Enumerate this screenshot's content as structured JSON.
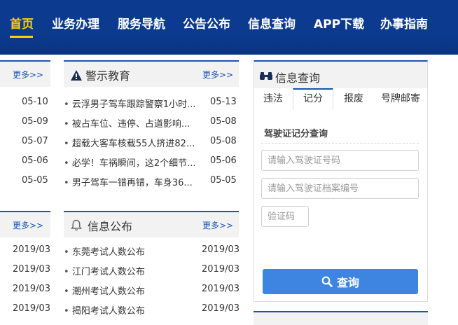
{
  "nav": {
    "items": [
      "首页",
      "业务办理",
      "服务导航",
      "公告公布",
      "信息查询",
      "APP下载",
      "办事指南"
    ]
  },
  "left_top": {
    "more": "更多>>",
    "dates": [
      "05-10",
      "05-09",
      "05-07",
      "05-06",
      "05-05"
    ]
  },
  "warning": {
    "title": "警示教育",
    "more": "更多>>",
    "rows": [
      {
        "text": "云浮男子驾车跟踪警察1小时...",
        "date": "05-13"
      },
      {
        "text": "被占车位、违停、占道影响...",
        "date": "05-08"
      },
      {
        "text": "超载大客车核载55人挤进82...",
        "date": "05-08"
      },
      {
        "text": "必学！车祸瞬间，这2个细节...",
        "date": "05-06"
      },
      {
        "text": "男子驾车一错再错，车身36...",
        "date": "05-05"
      }
    ]
  },
  "left_bottom": {
    "more": "更多>>",
    "dates": [
      "2019/03",
      "2019/03",
      "2019/03",
      "2019/03"
    ]
  },
  "info_pub": {
    "title": "信息公布",
    "more": "更多>>",
    "rows": [
      {
        "text": "东莞考试人数公布",
        "date": "2019/03"
      },
      {
        "text": "江门考试人数公布",
        "date": "2019/03"
      },
      {
        "text": "潮州考试人数公布",
        "date": "2019/03"
      },
      {
        "text": "揭阳考试人数公布",
        "date": "2019/03"
      }
    ]
  },
  "query": {
    "title": "信息查询",
    "tabs": [
      "违法",
      "记分",
      "报废",
      "号牌邮寄"
    ],
    "subtitle": "驾驶证记分查询",
    "license_placeholder": "请输入驾驶证号码",
    "file_placeholder": "请输入驾驶证档案编号",
    "captcha_placeholder": "验证码",
    "submit": "查询"
  },
  "colors": {
    "nav_bg": "#0b3a8e",
    "nav_active": "#ffd000",
    "accent": "#1a55b4",
    "button": "#3d85e0"
  }
}
